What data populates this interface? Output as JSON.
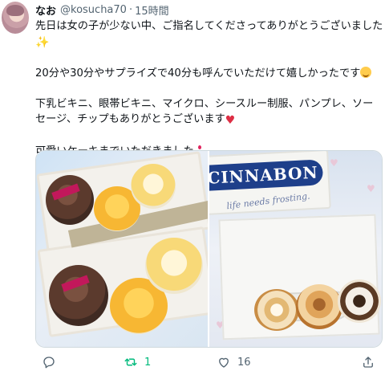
{
  "user": {
    "display_name": "なお",
    "handle": "@kosucha70",
    "separator": "·",
    "time": "15時間"
  },
  "tweet": {
    "line1": "先日は女の子が少ない中、ご指名してくださってありがとうございました",
    "line1_emoji": "sparkles-icon",
    "line2": "20分や30分やサプライズで40分も呼んでいただけて嬉しかったです",
    "line2_emoji": "smiling-face-icon",
    "line3a": "下乳ビキニ、眼帯ビキニ、マイクロ、シースルー制服、パンプレ、ソー",
    "line3b": "セージ、チップもありがとうございます",
    "line3_emoji": "red-heart-icon",
    "line4": "可愛いケーキまでいただきました",
    "line4_emoji": "shortcake-icon"
  },
  "media": {
    "left_photo": "cake-assortment-photo",
    "right_photo": "cinnabon-box-photo",
    "logo_text": "CINNABON",
    "script_text": "life needs frosting."
  },
  "actions": {
    "reply_count": "",
    "retweet_count": "1",
    "like_count": "16"
  },
  "colors": {
    "text": "#0f1419",
    "muted": "#536471",
    "retweet": "#00ba7c",
    "heart": "#dd2e44",
    "logo": "#1e3f8a"
  }
}
